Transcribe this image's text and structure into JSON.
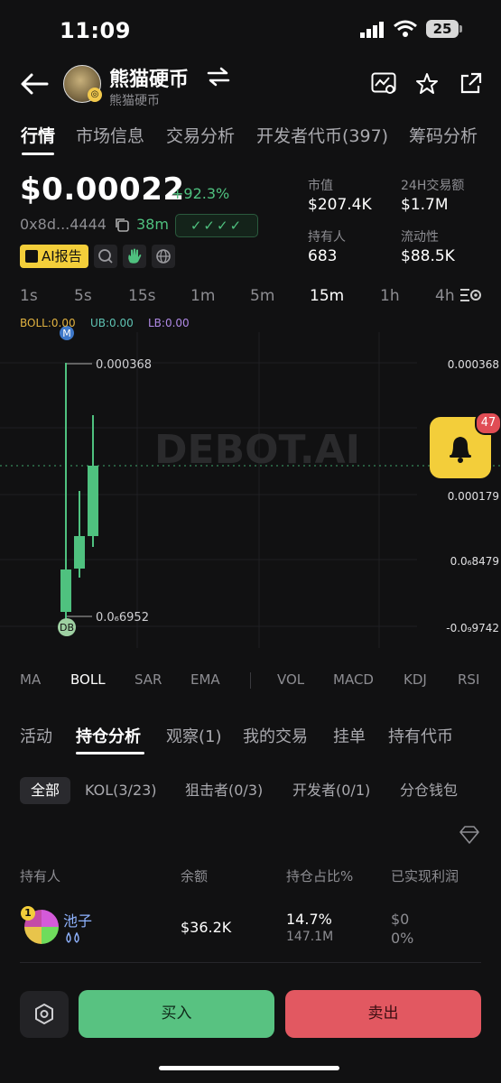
{
  "status": {
    "time": "11:09",
    "battery": "25"
  },
  "header": {
    "title": "熊猫硬币",
    "subtitle": "熊猫硬币"
  },
  "tabs": [
    {
      "label": "行情"
    },
    {
      "label": "市场信息"
    },
    {
      "label": "交易分析"
    },
    {
      "label": "开发者代币(397)"
    },
    {
      "label": "筹码分析"
    }
  ],
  "price": {
    "value": "$0.00022",
    "change": "+92.3%",
    "address": "0x8d...4444",
    "age": "38m",
    "checks": "✓✓✓✓",
    "ai_button": "AI报告"
  },
  "stats": [
    {
      "label": "市值",
      "value": "$207.4K"
    },
    {
      "label": "24H交易额",
      "value": "$1.7M"
    },
    {
      "label": "持有人",
      "value": "683"
    },
    {
      "label": "流动性",
      "value": "$88.5K"
    }
  ],
  "intervals": [
    "1s",
    "5s",
    "15s",
    "1m",
    "5m",
    "15m",
    "1h",
    "4h"
  ],
  "active_interval": "15m",
  "chart": {
    "boll": "BOLL:0.00",
    "ub": "UB:0.00",
    "lb": "LB:0.00",
    "watermark": "DEBOT.AI",
    "high_label": "0.000368",
    "low_label": "0.0₆6952",
    "marker_m": "M",
    "marker_db": "DB",
    "axis": [
      "0.000368",
      "0.000179",
      "0.0₆8479",
      "-0.0₉9742"
    ],
    "alert_count": "47"
  },
  "indicators": [
    "MA",
    "BOLL",
    "SAR",
    "EMA",
    "VOL",
    "MACD",
    "KDJ",
    "RSI"
  ],
  "sub_tabs": [
    {
      "label": "活动"
    },
    {
      "label": "持仓分析"
    },
    {
      "label": "观察(1)"
    },
    {
      "label": "我的交易"
    },
    {
      "label": "挂单"
    },
    {
      "label": "持有代币"
    }
  ],
  "filters": [
    "全部",
    "KOL(3/23)",
    "狙击者(0/3)",
    "开发者(0/1)",
    "分仓钱包"
  ],
  "table": {
    "headers": [
      "持有人",
      "余额",
      "持仓占比%",
      "已实现利润"
    ],
    "rows": [
      {
        "rank": "1",
        "name": "池子",
        "balance": "$36.2K",
        "pct": "14.7%",
        "amount": "147.1M",
        "profit": "$0",
        "profit_pct": "0%"
      }
    ]
  },
  "actions": {
    "buy": "买入",
    "sell": "卖出"
  },
  "colors": {
    "accent": "#f3ce3a",
    "up": "#4fc17f",
    "down": "#e25861",
    "bg": "#111112"
  }
}
